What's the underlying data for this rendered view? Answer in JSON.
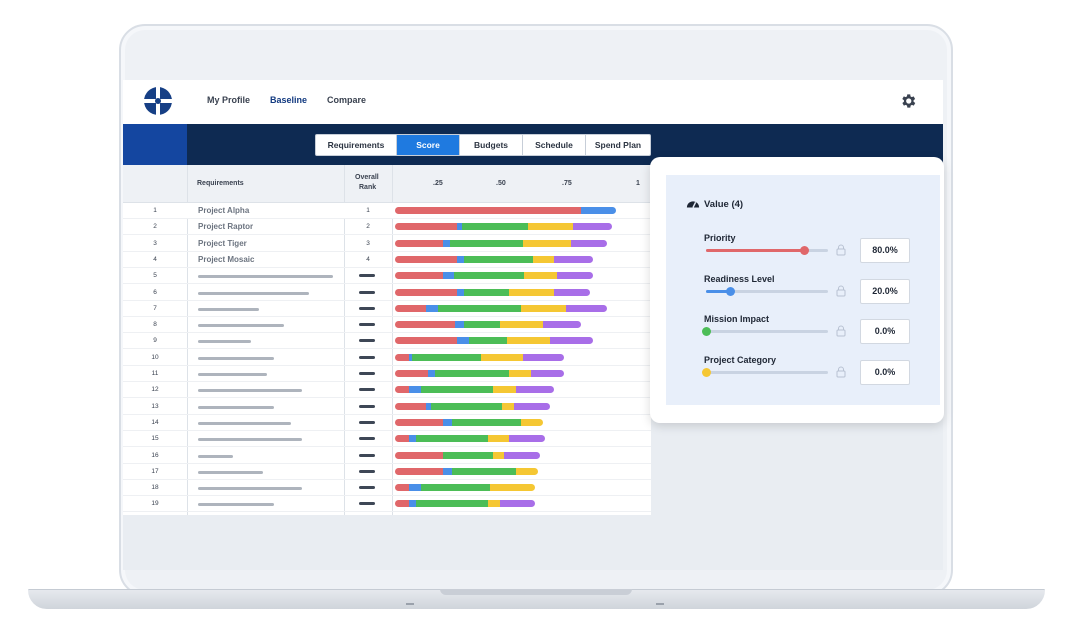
{
  "nav": {
    "items": [
      "My Profile",
      "Baseline",
      "Compare"
    ],
    "active": "Baseline"
  },
  "tabs": {
    "items": [
      "Requirements",
      "Score",
      "Budgets",
      "Schedule",
      "Spend Plan"
    ],
    "active": "Score"
  },
  "table": {
    "headers": {
      "requirements": "Requirements",
      "rank_line1": "Overall",
      "rank_line2": "Rank"
    },
    "scale_ticks": [
      ".25",
      ".50",
      ".75",
      "1"
    ],
    "rows": [
      {
        "num": "1",
        "name": "Project Alpha",
        "rank": "1"
      },
      {
        "num": "2",
        "name": "Project Raptor",
        "rank": "2"
      },
      {
        "num": "3",
        "name": "Project Tiger",
        "rank": "3"
      },
      {
        "num": "4",
        "name": "Project Mosaic",
        "rank": "4"
      },
      {
        "num": "5"
      },
      {
        "num": "6"
      },
      {
        "num": "7"
      },
      {
        "num": "8"
      },
      {
        "num": "9"
      },
      {
        "num": "10"
      },
      {
        "num": "11"
      },
      {
        "num": "12"
      },
      {
        "num": "13"
      },
      {
        "num": "14"
      },
      {
        "num": "15"
      },
      {
        "num": "16"
      },
      {
        "num": "17"
      },
      {
        "num": "18"
      },
      {
        "num": "19"
      }
    ],
    "colors": {
      "priority": "#e0676a",
      "readiness": "#4a8fe8",
      "mission": "#4cbd57",
      "category": "#f5c733",
      "extra": "#a86ee8"
    },
    "score_segments": [
      [
        0.78,
        0.15,
        0,
        0,
        0
      ],
      [
        0.26,
        0.02,
        0.28,
        0.19,
        0.16
      ],
      [
        0.2,
        0.03,
        0.31,
        0.2,
        0.15
      ],
      [
        0.26,
        0.03,
        0.29,
        0.09,
        0.16
      ],
      [
        0.2,
        0.05,
        0.29,
        0.14,
        0.15
      ],
      [
        0.26,
        0.03,
        0.19,
        0.19,
        0.15
      ],
      [
        0.13,
        0.05,
        0.35,
        0.19,
        0.17
      ],
      [
        0.25,
        0.04,
        0.15,
        0.18,
        0.16
      ],
      [
        0.26,
        0.05,
        0.16,
        0.18,
        0.18
      ],
      [
        0.06,
        0.01,
        0.29,
        0.18,
        0.17
      ],
      [
        0.14,
        0.03,
        0.31,
        0.09,
        0.14
      ],
      [
        0.06,
        0.05,
        0.3,
        0.1,
        0.16
      ],
      [
        0.13,
        0.02,
        0.3,
        0.05,
        0.15
      ],
      [
        0.2,
        0.04,
        0.29,
        0.09,
        0
      ],
      [
        0.06,
        0.03,
        0.3,
        0.09,
        0.15
      ],
      [
        0.2,
        0.0,
        0.21,
        0.05,
        0.15
      ],
      [
        0.2,
        0.04,
        0.27,
        0.09,
        0
      ],
      [
        0.06,
        0.05,
        0.29,
        0.19,
        0
      ],
      [
        0.06,
        0.03,
        0.3,
        0.05,
        0.15
      ]
    ],
    "placeholder_fraction": [
      0,
      0,
      0,
      0,
      1.0,
      0.82,
      0.45,
      0.64,
      0.39,
      0.56,
      0.51,
      0.77,
      0.56,
      0.69,
      0.77,
      0.26,
      0.48,
      0.77,
      0.56
    ]
  },
  "panel": {
    "title": "Value (4)",
    "sliders": [
      {
        "label": "Priority",
        "value": "80.0%",
        "level": 0.8,
        "color": "#e0676a"
      },
      {
        "label": "Readiness Level",
        "value": "20.0%",
        "level": 0.2,
        "color": "#4a8fe8"
      },
      {
        "label": "Mission Impact",
        "value": "0.0%",
        "level": 0.0,
        "color": "#4cbd57"
      },
      {
        "label": "Project Category",
        "value": "0.0%",
        "level": 0.0,
        "color": "#f5c733"
      }
    ]
  }
}
